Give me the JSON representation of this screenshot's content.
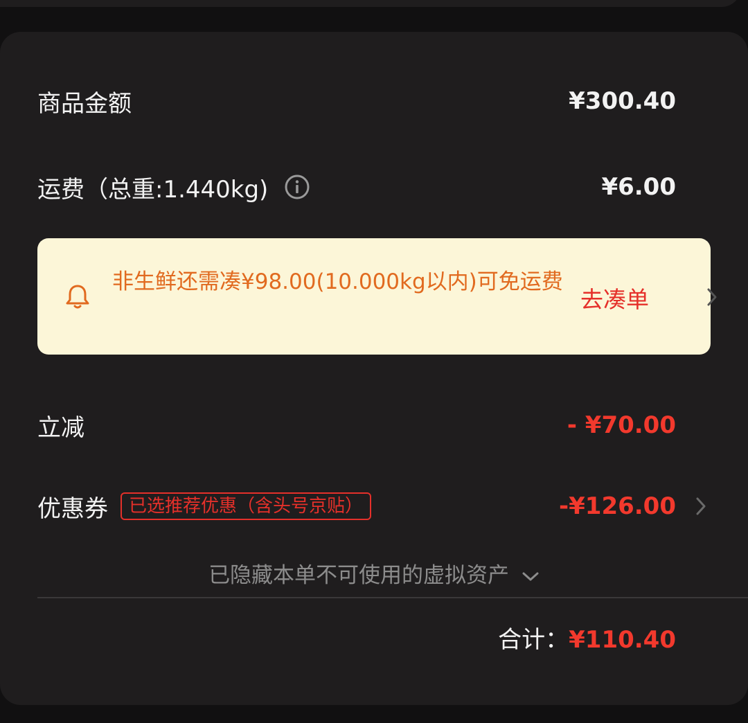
{
  "summary": {
    "goods_amount": {
      "label": "商品金额",
      "value": "¥300.40"
    },
    "shipping": {
      "label": "运费（总重:1.440kg)",
      "value": "¥6.00"
    },
    "notice": {
      "text": "非生鲜还需凑¥98.00(10.000kg以内)可免运费",
      "action": "去凑单"
    },
    "discount": {
      "label": "立减",
      "value": "- ¥70.00"
    },
    "coupon": {
      "label": "优惠券",
      "badge": "已选推荐优惠（含头号京贴）",
      "value": "-¥126.00"
    },
    "hidden_assets": "已隐藏本单不可使用的虚拟资产",
    "total": {
      "label": "合计：",
      "value": "¥110.40"
    }
  },
  "colors": {
    "background": "#111011",
    "card": "#1f1d1e",
    "notice_bg": "#fcf6d8",
    "notice_text": "#e16a1f",
    "accent_red": "#f2392d"
  }
}
